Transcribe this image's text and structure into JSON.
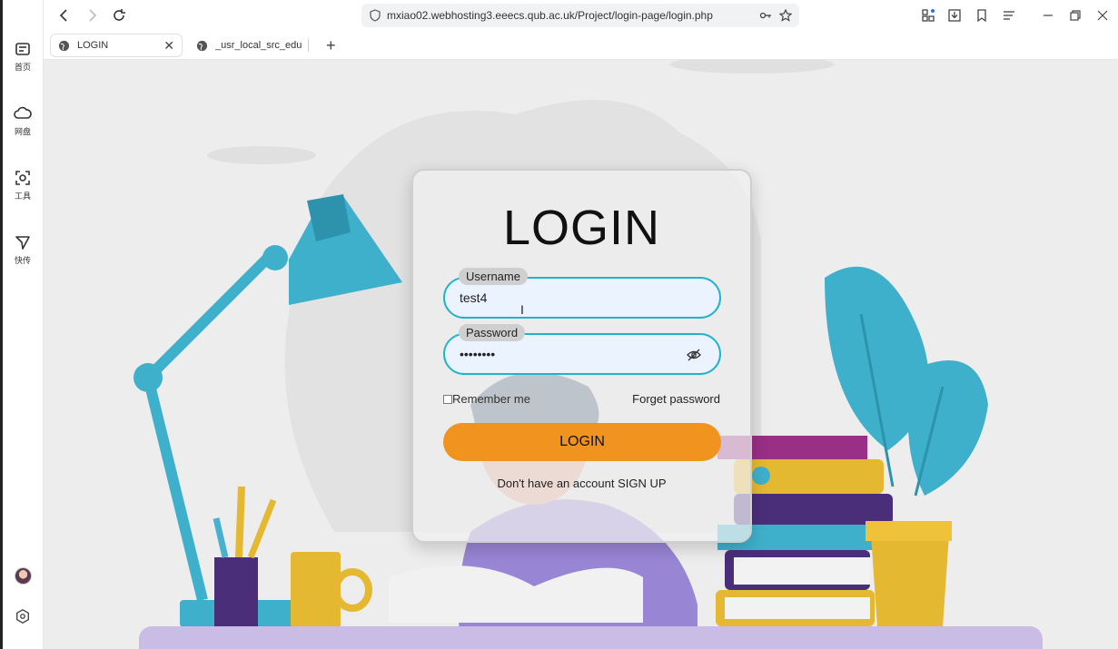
{
  "rail": {
    "items": [
      {
        "label": "首页"
      },
      {
        "label": "网盘"
      },
      {
        "label": "工具"
      },
      {
        "label": "快传"
      }
    ]
  },
  "browser": {
    "url": "mxiao02.webhosting3.eeecs.qub.ac.uk/Project/login-page/login.php",
    "tabs": [
      {
        "label": "LOGIN"
      },
      {
        "label": "_usr_local_src_education"
      }
    ]
  },
  "login": {
    "title": "LOGIN",
    "username_label": "Username",
    "username_value": "test4",
    "password_label": "Password",
    "password_value": "••••••••",
    "remember_label": "Remember me",
    "forget_label": "Forget password",
    "button_label": "LOGIN",
    "signup_prefix": "Don't have an account",
    "signup_link": "SIGN UP"
  },
  "colors": {
    "field_border": "#21b4c9",
    "button": "#f0931f",
    "accent_teal": "#3fb0cc"
  }
}
